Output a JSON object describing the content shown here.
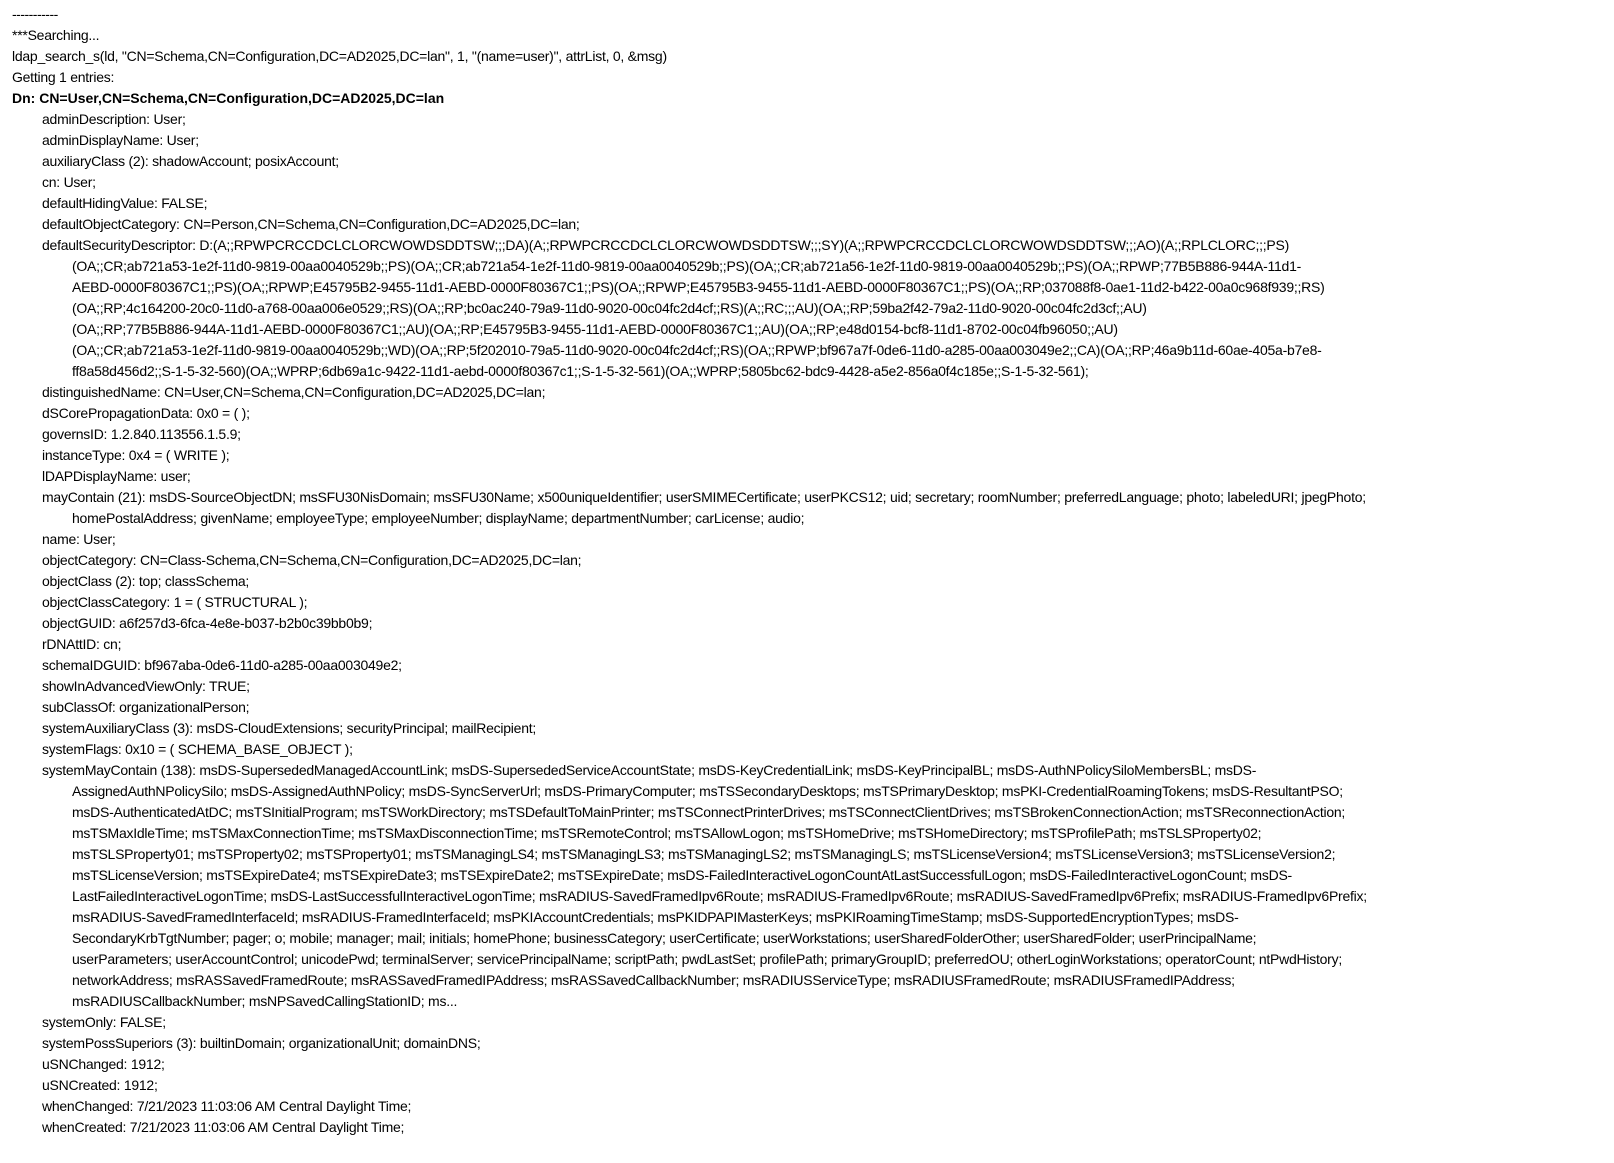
{
  "output": {
    "separator": "-----------",
    "searching": "***Searching...",
    "search_call": "ldap_search_s(ld, \"CN=Schema,CN=Configuration,DC=AD2025,DC=lan\", 1, \"(name=user)\", attrList,  0, &msg)",
    "entries": "Getting 1 entries:",
    "dn": "Dn: CN=User,CN=Schema,CN=Configuration,DC=AD2025,DC=lan",
    "attributes": [
      "adminDescription: User;",
      "adminDisplayName: User;",
      "auxiliaryClass (2): shadowAccount; posixAccount;",
      "cn: User;",
      "defaultHidingValue: FALSE;",
      "defaultObjectCategory: CN=Person,CN=Schema,CN=Configuration,DC=AD2025,DC=lan;"
    ],
    "sd": {
      "first": "defaultSecurityDescriptor: D:(A;;RPWPCRCCDCLCLORCWOWDSDDTSW;;;DA)(A;;RPWPCRCCDCLCLORCWOWDSDDTSW;;;SY)(A;;RPWPCRCCDCLCLORCWOWDSDDTSW;;;AO)(A;;RPLCLORC;;;PS)",
      "cont": [
        "(OA;;CR;ab721a53-1e2f-11d0-9819-00aa0040529b;;PS)(OA;;CR;ab721a54-1e2f-11d0-9819-00aa0040529b;;PS)(OA;;CR;ab721a56-1e2f-11d0-9819-00aa0040529b;;PS)(OA;;RPWP;77B5B886-944A-11d1-",
        "AEBD-0000F80367C1;;PS)(OA;;RPWP;E45795B2-9455-11d1-AEBD-0000F80367C1;;PS)(OA;;RPWP;E45795B3-9455-11d1-AEBD-0000F80367C1;;PS)(OA;;RP;037088f8-0ae1-11d2-b422-00a0c968f939;;RS)",
        "(OA;;RP;4c164200-20c0-11d0-a768-00aa006e0529;;RS)(OA;;RP;bc0ac240-79a9-11d0-9020-00c04fc2d4cf;;RS)(A;;RC;;;AU)(OA;;RP;59ba2f42-79a2-11d0-9020-00c04fc2d3cf;;AU)",
        "(OA;;RP;77B5B886-944A-11d1-AEBD-0000F80367C1;;AU)(OA;;RP;E45795B3-9455-11d1-AEBD-0000F80367C1;;AU)(OA;;RP;e48d0154-bcf8-11d1-8702-00c04fb96050;;AU)",
        "(OA;;CR;ab721a53-1e2f-11d0-9819-00aa0040529b;;WD)(OA;;RP;5f202010-79a5-11d0-9020-00c04fc2d4cf;;RS)(OA;;RPWP;bf967a7f-0de6-11d0-a285-00aa003049e2;;CA)(OA;;RP;46a9b11d-60ae-405a-b7e8-",
        "ff8a58d456d2;;S-1-5-32-560)(OA;;WPRP;6db69a1c-9422-11d1-aebd-0000f80367c1;;S-1-5-32-561)(OA;;WPRP;5805bc62-bdc9-4428-a5e2-856a0f4c185e;;S-1-5-32-561);"
      ]
    },
    "attributes2": [
      "distinguishedName: CN=User,CN=Schema,CN=Configuration,DC=AD2025,DC=lan;",
      "dSCorePropagationData: 0x0 = (  );",
      "governsID: 1.2.840.113556.1.5.9;",
      "instanceType: 0x4 = ( WRITE );",
      "lDAPDisplayName: user;"
    ],
    "may_contain": {
      "first": "mayContain (21): msDS-SourceObjectDN; msSFU30NisDomain; msSFU30Name; x500uniqueIdentifier; userSMIMECertificate; userPKCS12; uid; secretary; roomNumber; preferredLanguage; photo; labeledURI; jpegPhoto;",
      "cont": [
        "homePostalAddress; givenName; employeeType; employeeNumber; displayName; departmentNumber; carLicense; audio;"
      ]
    },
    "attributes3": [
      "name: User;",
      "objectCategory: CN=Class-Schema,CN=Schema,CN=Configuration,DC=AD2025,DC=lan;",
      "objectClass (2): top; classSchema;",
      "objectClassCategory: 1 = ( STRUCTURAL );",
      "objectGUID: a6f257d3-6fca-4e8e-b037-b2b0c39bb0b9;",
      "rDNAttID: cn;",
      "schemaIDGUID: bf967aba-0de6-11d0-a285-00aa003049e2;",
      "showInAdvancedViewOnly: TRUE;",
      "subClassOf: organizationalPerson;",
      "systemAuxiliaryClass (3): msDS-CloudExtensions; securityPrincipal; mailRecipient;",
      "systemFlags: 0x10 = ( SCHEMA_BASE_OBJECT );"
    ],
    "system_may_contain": {
      "first": "systemMayContain (138): msDS-SupersededManagedAccountLink; msDS-SupersededServiceAccountState; msDS-KeyCredentialLink; msDS-KeyPrincipalBL; msDS-AuthNPolicySiloMembersBL; msDS-",
      "cont": [
        "AssignedAuthNPolicySilo; msDS-AssignedAuthNPolicy; msDS-SyncServerUrl; msDS-PrimaryComputer; msTSSecondaryDesktops; msTSPrimaryDesktop; msPKI-CredentialRoamingTokens; msDS-ResultantPSO;",
        "msDS-AuthenticatedAtDC; msTSInitialProgram; msTSWorkDirectory; msTSDefaultToMainPrinter; msTSConnectPrinterDrives; msTSConnectClientDrives; msTSBrokenConnectionAction; msTSReconnectionAction;",
        "msTSMaxIdleTime; msTSMaxConnectionTime; msTSMaxDisconnectionTime; msTSRemoteControl; msTSAllowLogon; msTSHomeDrive; msTSHomeDirectory; msTSProfilePath; msTSLSProperty02;",
        "msTSLSProperty01; msTSProperty02; msTSProperty01; msTSManagingLS4; msTSManagingLS3; msTSManagingLS2; msTSManagingLS; msTSLicenseVersion4; msTSLicenseVersion3; msTSLicenseVersion2;",
        "msTSLicenseVersion; msTSExpireDate4; msTSExpireDate3; msTSExpireDate2; msTSExpireDate; msDS-FailedInteractiveLogonCountAtLastSuccessfulLogon; msDS-FailedInteractiveLogonCount; msDS-",
        "LastFailedInteractiveLogonTime; msDS-LastSuccessfulInteractiveLogonTime; msRADIUS-SavedFramedIpv6Route; msRADIUS-FramedIpv6Route; msRADIUS-SavedFramedIpv6Prefix; msRADIUS-FramedIpv6Prefix;",
        "msRADIUS-SavedFramedInterfaceId; msRADIUS-FramedInterfaceId; msPKIAccountCredentials; msPKIDPAPIMasterKeys; msPKIRoamingTimeStamp; msDS-SupportedEncryptionTypes; msDS-",
        "SecondaryKrbTgtNumber; pager; o; mobile; manager; mail; initials; homePhone; businessCategory; userCertificate; userWorkstations; userSharedFolderOther; userSharedFolder; userPrincipalName;",
        "userParameters; userAccountControl; unicodePwd; terminalServer; servicePrincipalName; scriptPath; pwdLastSet; profilePath; primaryGroupID; preferredOU; otherLoginWorkstations; operatorCount; ntPwdHistory;",
        "networkAddress; msRASSavedFramedRoute; msRASSavedFramedIPAddress; msRASSavedCallbackNumber; msRADIUSServiceType; msRADIUSFramedRoute; msRADIUSFramedIPAddress;",
        "msRADIUSCallbackNumber; msNPSavedCallingStationID; ms..."
      ]
    },
    "attributes4": [
      "systemOnly: FALSE;",
      "systemPossSuperiors (3): builtinDomain; organizationalUnit; domainDNS;",
      "uSNChanged: 1912;",
      "uSNCreated: 1912;",
      "whenChanged: 7/21/2023 11:03:06 AM Central Daylight Time;",
      "whenCreated: 7/21/2023 11:03:06 AM Central Daylight Time;"
    ]
  }
}
